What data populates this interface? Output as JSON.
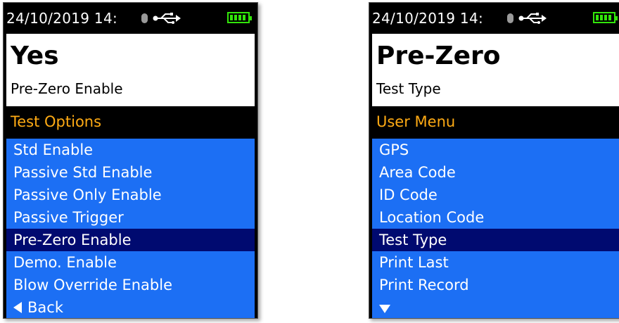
{
  "screens": [
    {
      "datetime": "24/10/2019  14:",
      "title": "Yes",
      "subtitle": "Pre-Zero Enable",
      "section": "Test Options",
      "items": [
        "Std Enable",
        "Passive Std Enable",
        "Passive Only Enable",
        "Passive Trigger",
        "Pre-Zero Enable",
        "Demo. Enable",
        "Blow Override Enable"
      ],
      "selected_index": 4,
      "back_label": "Back"
    },
    {
      "datetime": "24/10/2019  14:",
      "title": "Pre-Zero",
      "subtitle": "Test Type",
      "section": "User Menu",
      "items": [
        "GPS",
        "Area Code",
        "ID Code",
        "Location Code",
        "Test Type",
        "Print Last",
        "Print Record"
      ],
      "selected_index": 4
    }
  ],
  "icons": {
    "bluetooth": "bluetooth-icon",
    "usb": "usb-icon",
    "battery": "battery-icon",
    "back": "back-arrow-icon",
    "more": "down-arrow-icon"
  },
  "colors": {
    "list_bg": "#1c6ff4",
    "selected_bg": "#000a70",
    "section_text": "#ffab14",
    "battery": "#32e60a"
  }
}
